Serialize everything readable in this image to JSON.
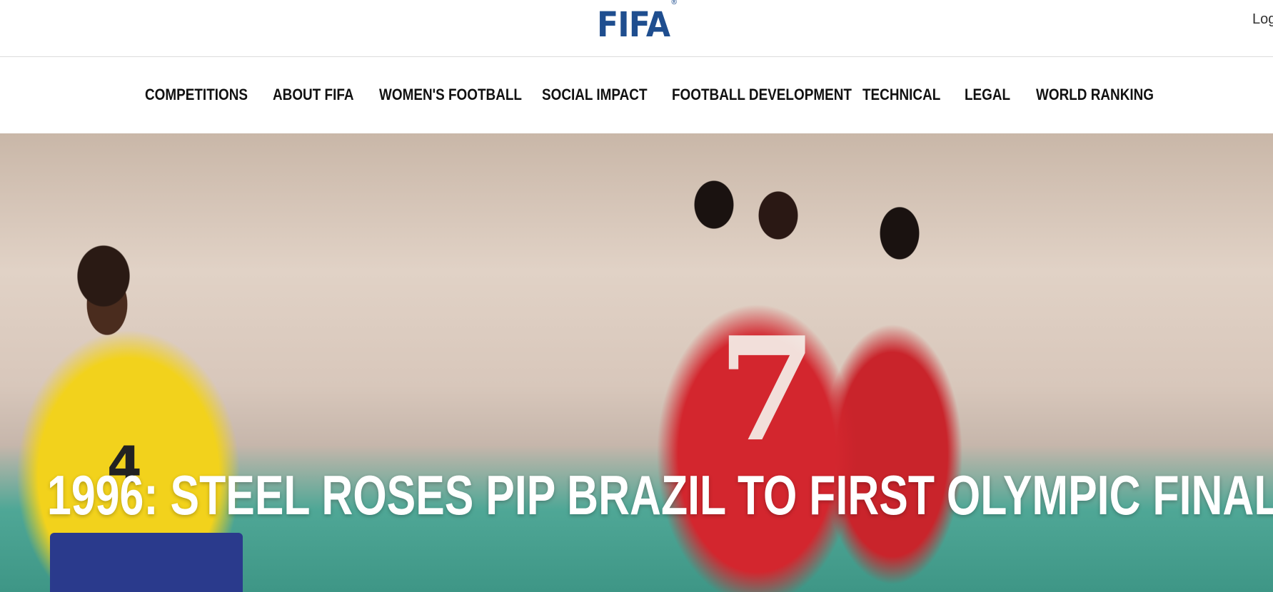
{
  "header": {
    "logo_text": "FIFA",
    "logo_mark": "®",
    "login_label": "Log",
    "brand_color": "#1f4e8f"
  },
  "nav": {
    "items": [
      {
        "label": "COMPETITIONS"
      },
      {
        "label": "ABOUT FIFA"
      },
      {
        "label": "WOMEN'S FOOTBALL"
      },
      {
        "label": "SOCIAL IMPACT"
      },
      {
        "label": "FOOTBALL DEVELOPMENT"
      },
      {
        "label": "TECHNICAL"
      },
      {
        "label": "LEGAL"
      },
      {
        "label": "WORLD RANKING"
      }
    ]
  },
  "hero": {
    "title": "1996: STEEL ROSES PIP BRAZIL TO FIRST OLYMPIC FINAL",
    "shirt_number_large": "7",
    "shirt_number_small": "4"
  }
}
